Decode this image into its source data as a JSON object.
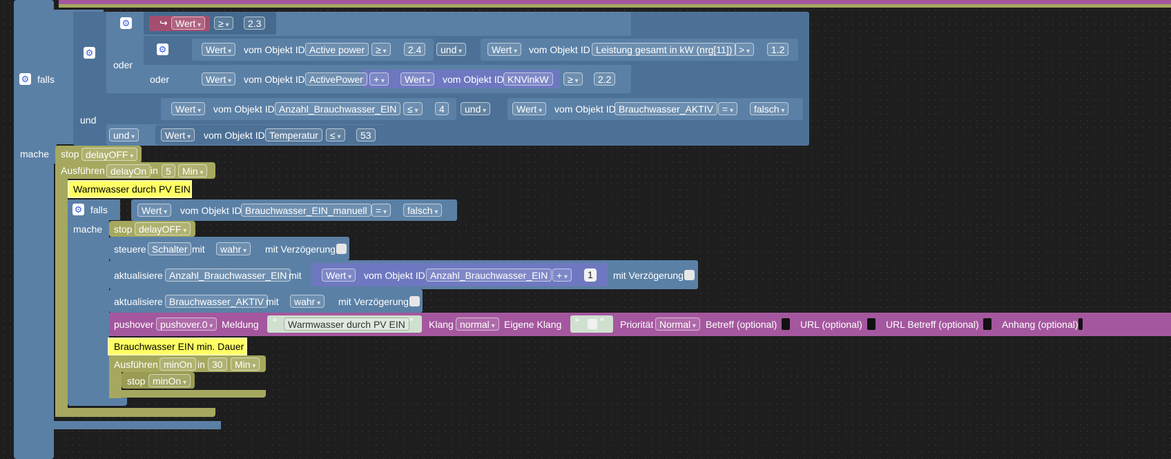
{
  "labels": {
    "falls": "falls",
    "mache": "mache",
    "und": "und",
    "oder": "oder",
    "wert": "Wert",
    "vom_objekt_id": "vom Objekt ID",
    "stop": "stop",
    "ausfuehren": "Ausführen",
    "in": "in",
    "steuere": "steuere",
    "mit": "mit",
    "mit_verzoegerung": "mit Verzögerung",
    "aktualisiere": "aktualisiere",
    "pushover": "pushover",
    "meldung": "Meldung",
    "klang": "Klang",
    "eigene_klang": "Eigene Klang",
    "prioritaet": "Priorität",
    "betreff": "Betreff (optional)",
    "url": "URL (optional)",
    "url_betreff": "URL Betreff (optional)",
    "anhang": "Anhang (optional)",
    "quote_open": "“",
    "quote_close": "”"
  },
  "ops": {
    "ge": "≥",
    "le": "≤",
    "gt": ">",
    "eq": "=",
    "plus": "+"
  },
  "condition": {
    "cond1_threshold": "2.3",
    "active_power_obj": "Active power",
    "active_power_threshold": "2.4",
    "leistung_obj": "Leistung gesamt in kW (nrg[11])",
    "leistung_threshold": "1.2",
    "activepower_obj": "ActivePower",
    "knvinkw_obj": "KNVinkW",
    "sum_threshold": "2.2",
    "anzahl_obj": "Anzahl_Brauchwasser_EIN",
    "anzahl_threshold": "4",
    "aktiv_obj": "Brauchwasser_AKTIV",
    "aktiv_value": "falsch",
    "temp_obj": "Temperatur",
    "temp_threshold": "53"
  },
  "actions": {
    "delay_off": "delayOFF",
    "delay_on": "delayOn",
    "delay_minutes": "5",
    "min_unit": "Min",
    "comment_pv": "Warmwasser durch PV EIN",
    "manual_obj": "Brauchwasser_EIN_manuell",
    "manual_value": "falsch",
    "schalter": "Schalter",
    "wahr": "wahr",
    "anzahl_obj": "Anzahl_Brauchwasser_EIN",
    "increment": "1",
    "aktiv_obj": "Brauchwasser_AKTIV",
    "pushover_instance": "pushover.0",
    "message": "Warmwasser durch PV EIN",
    "sound": "normal",
    "priority": "Normal",
    "comment_min": "Brauchwasser EIN min. Dauer",
    "min_on": "minOn",
    "min_on_minutes": "30"
  },
  "colors": {
    "logic": "#5b80a5",
    "values": "#7785c9",
    "control": "#a5a85e",
    "pushover": "#a4579e",
    "comment": "#ffff64",
    "workspace": "#1e1e1e"
  },
  "icons": {
    "gear": "gear-icon",
    "arrow": "return-arrow-icon"
  }
}
